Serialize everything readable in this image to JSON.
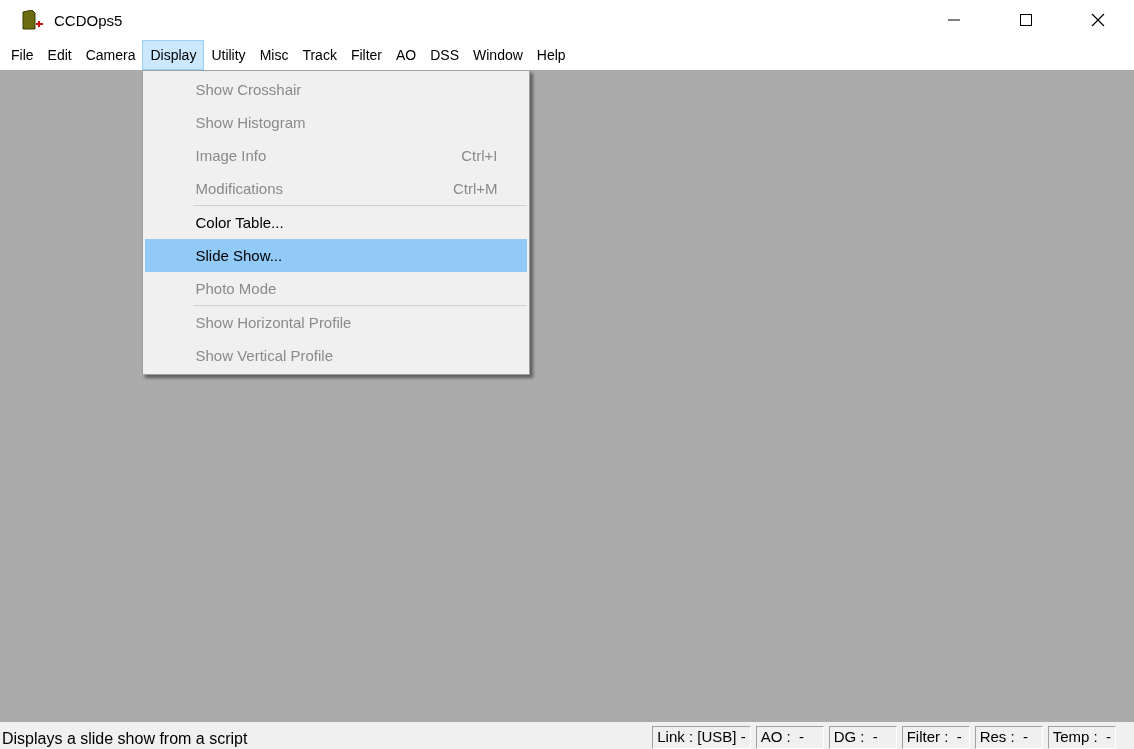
{
  "window": {
    "title": "CCDOps5"
  },
  "menu_bar": [
    {
      "label": "File",
      "selected": false
    },
    {
      "label": "Edit",
      "selected": false
    },
    {
      "label": "Camera",
      "selected": false
    },
    {
      "label": "Display",
      "selected": true
    },
    {
      "label": "Utility",
      "selected": false
    },
    {
      "label": "Misc",
      "selected": false
    },
    {
      "label": "Track",
      "selected": false
    },
    {
      "label": "Filter",
      "selected": false
    },
    {
      "label": "AO",
      "selected": false
    },
    {
      "label": "DSS",
      "selected": false
    },
    {
      "label": "Window",
      "selected": false
    },
    {
      "label": "Help",
      "selected": false
    }
  ],
  "dropdown": [
    {
      "kind": "item",
      "label": "Show Crosshair",
      "disabled": true,
      "selected": false
    },
    {
      "kind": "item",
      "label": "Show Histogram",
      "disabled": true,
      "selected": false
    },
    {
      "kind": "item",
      "label": "Image Info",
      "shortcut": "Ctrl+I",
      "disabled": true,
      "selected": false
    },
    {
      "kind": "item",
      "label": "Modifications",
      "shortcut": "Ctrl+M",
      "disabled": true,
      "selected": false
    },
    {
      "kind": "separator"
    },
    {
      "kind": "item",
      "label": "Color Table...",
      "disabled": false,
      "selected": false
    },
    {
      "kind": "item",
      "label": "Slide Show...",
      "disabled": false,
      "selected": true
    },
    {
      "kind": "item",
      "label": "Photo Mode",
      "disabled": true,
      "selected": false
    },
    {
      "kind": "separator"
    },
    {
      "kind": "item",
      "label": "Show Horizontal Profile",
      "disabled": true,
      "selected": false
    },
    {
      "kind": "item",
      "label": "Show Vertical Profile",
      "disabled": true,
      "selected": false
    }
  ],
  "status_bar": {
    "message": "Displays a slide show from a script",
    "panes": [
      "Link : [USB] -",
      "AO :  -",
      "DG :  -",
      "Filter :  -",
      "Res :  -",
      "Temp :  -"
    ]
  }
}
